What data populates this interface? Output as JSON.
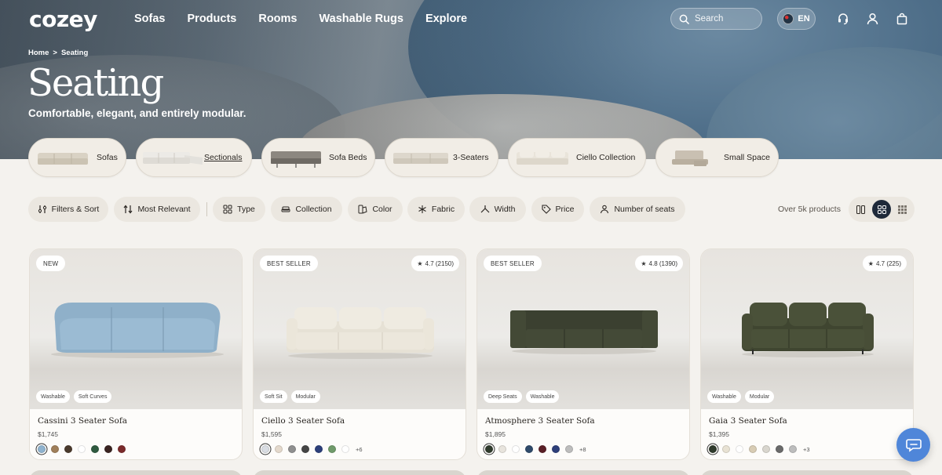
{
  "brand": {
    "logo": "cozey"
  },
  "nav": {
    "links": [
      "Sofas",
      "Products",
      "Rooms",
      "Washable Rugs",
      "Explore"
    ],
    "search_placeholder": "Search",
    "language": "EN"
  },
  "breadcrumb": {
    "home": "Home",
    "separator": ">",
    "current": "Seating"
  },
  "hero": {
    "title": "Seating",
    "subtitle": "Comfortable, elegant, and entirely modular."
  },
  "categories": [
    {
      "label": "Sofas"
    },
    {
      "label": "Sectionals",
      "active": true
    },
    {
      "label": "Sofa Beds"
    },
    {
      "label": "3-Seaters"
    },
    {
      "label": "Ciello Collection"
    },
    {
      "label": "Small Space"
    }
  ],
  "filters": {
    "filters_sort": "Filters & Sort",
    "sort": "Most Relevant",
    "type": "Type",
    "collection": "Collection",
    "color": "Color",
    "fabric": "Fabric",
    "width": "Width",
    "price": "Price",
    "seats": "Number of seats",
    "count": "Over 5k products"
  },
  "products": [
    {
      "badge": "NEW",
      "rating": "",
      "tags": [
        "Washable",
        "Soft Curves"
      ],
      "name": "Cassini 3 Seater Sofa",
      "price": "$1,745",
      "swatches": [
        "#8fb3cf",
        "#a07f5a",
        "#4a3a2c",
        "#ffffff",
        "#2f5a3f",
        "#3a2320",
        "#7a2a2a"
      ],
      "more": "",
      "sofa_color": "#8fb0c9"
    },
    {
      "badge": "BEST SELLER",
      "rating": "4.7 (2150)",
      "tags": [
        "Soft Sit",
        "Modular"
      ],
      "name": "Ciello 3 Seater Sofa",
      "price": "$1,595",
      "swatches": [
        "#d9dde3",
        "#e4d9cc",
        "#8f8f8f",
        "#454545",
        "#2c3f7a",
        "#6f9a6a",
        "#ffffff"
      ],
      "more": "+6",
      "sofa_color": "#e9e4d8"
    },
    {
      "badge": "BEST SELLER",
      "rating": "4.8 (1390)",
      "tags": [
        "Deep Seats",
        "Washable"
      ],
      "name": "Atmosphere 3 Seater Sofa",
      "price": "$1,895",
      "swatches": [
        "#2f3a2c",
        "#e8e4dd",
        "#ffffff",
        "#2f4a6a",
        "#5a1f26",
        "#2e3f7a",
        "#bdbdbd"
      ],
      "more": "+8",
      "sofa_color": "#3b4030"
    },
    {
      "badge": "",
      "rating": "4.7 (225)",
      "tags": [
        "Washable",
        "Modular"
      ],
      "name": "Gaia 3 Seater Sofa",
      "price": "$1,395",
      "swatches": [
        "#2f3a2c",
        "#e8e2d3",
        "#ffffff",
        "#d8ccb4",
        "#d9d6ce",
        "#6a6a6a",
        "#bdbdbd"
      ],
      "more": "+3",
      "sofa_color": "#3f4530"
    }
  ]
}
